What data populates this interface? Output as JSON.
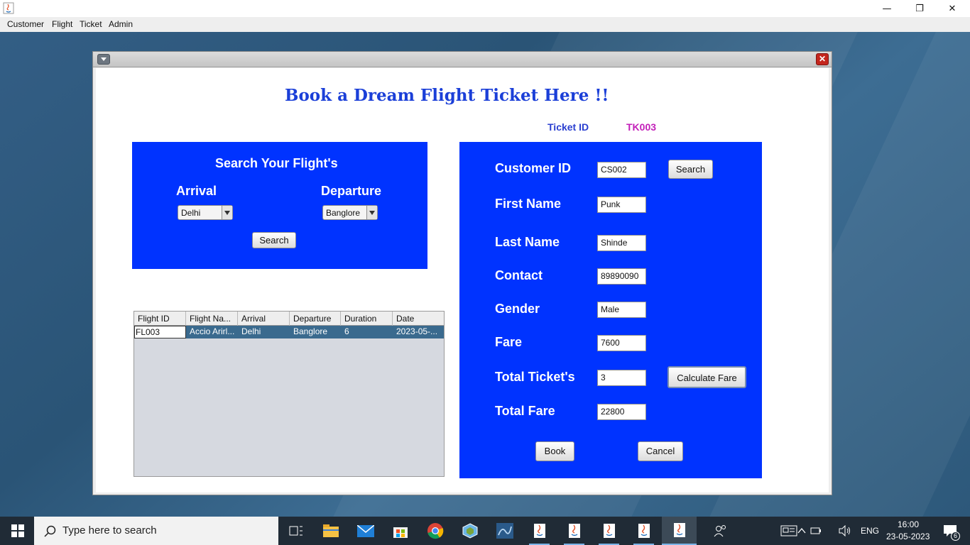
{
  "app": {
    "menu": [
      "Customer",
      "Flight",
      "Ticket",
      "Admin"
    ],
    "controls": {
      "minimize": "—",
      "maximize": "❐",
      "close": "✕"
    }
  },
  "frame": {
    "close_glyph": "✕",
    "title": "Book a Dream Flight Ticket Here !!",
    "ticket_id_label": "Ticket ID",
    "ticket_id_value": "TK003"
  },
  "search": {
    "title": "Search Your Flight's",
    "arrival_label": "Arrival",
    "departure_label": "Departure",
    "arrival_value": "Delhi",
    "departure_value": "Banglore",
    "search_button": "Search"
  },
  "table": {
    "columns": [
      "Flight ID",
      "Flight Na...",
      "Arrival",
      "Departure",
      "Duration",
      "Date"
    ],
    "rows": [
      [
        "FL003",
        "Accio Arirl...",
        "Delhi",
        "Banglore",
        "6",
        "2023-05-..."
      ]
    ]
  },
  "customer": {
    "labels": {
      "customer_id": "Customer ID",
      "first_name": "First Name",
      "last_name": "Last Name",
      "contact": "Contact",
      "gender": "Gender",
      "fare": "Fare",
      "total_tickets": "Total Ticket's",
      "total_fare": "Total Fare"
    },
    "values": {
      "customer_id": "CS002",
      "first_name": "Punk",
      "last_name": "Shinde",
      "contact": "89890090",
      "gender": "Male",
      "fare": "7600",
      "total_tickets": "3",
      "total_fare": "22800"
    },
    "search_button": "Search",
    "calculate_button": "Calculate Fare",
    "book_button": "Book",
    "cancel_button": "Cancel"
  },
  "taskbar": {
    "search_placeholder": "Type here to search",
    "language": "ENG",
    "time": "16:00",
    "date": "23-05-2023",
    "notification_count": "6"
  }
}
